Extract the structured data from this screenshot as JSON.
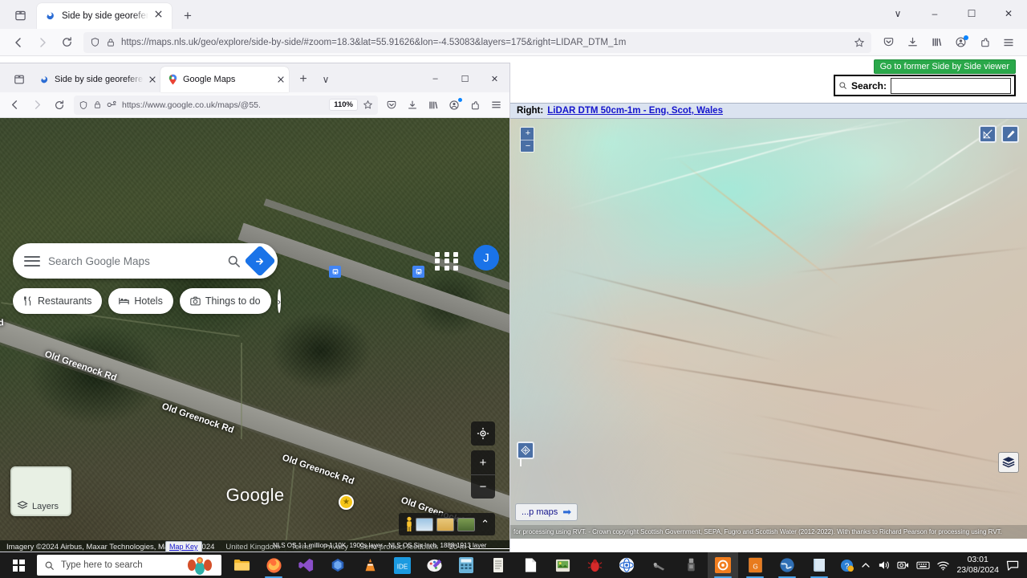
{
  "outer_browser": {
    "tab": {
      "title": "Side by side georeferenced map",
      "favicon": "firefox-icon"
    },
    "tab_list_icon": "tab-list-icon",
    "new_tab_label": "+",
    "nav": {
      "back": "back-arrow-icon",
      "forward": "forward-arrow-icon",
      "reload": "reload-icon"
    },
    "url": {
      "scheme": "https://",
      "domain_pre": "maps.",
      "domain_bold": "nls.uk",
      "path": "/geo/explore/side-by-side/#zoom=18.3&lat=55.91626&lon=-4.53083&layers=175&right=LIDAR_DTM_1m",
      "full": "https://maps.nls.uk/geo/explore/side-by-side/#zoom=18.3&lat=55.91626&lon=-4.53083&layers=175&right=LIDAR_DTM_1m",
      "shield_icon": "shield-icon",
      "lock_icon": "lock-icon",
      "bookmark_icon": "star-bookmark-icon"
    },
    "toolbar_icons": [
      "pocket-icon",
      "downloads-icon",
      "library-icon",
      "account-icon",
      "extensions-icon",
      "menu-icon"
    ],
    "window_controls": {
      "minimize": "–",
      "maximize": "☐",
      "close": "✕",
      "chevron": "∨"
    }
  },
  "inner_browser": {
    "tabs": [
      {
        "title": "Side by side georeferenced map",
        "favicon": "firefox-icon",
        "active": false
      },
      {
        "title": "Google Maps",
        "favicon": "gmaps-pin-icon",
        "active": true
      }
    ],
    "new_tab_label": "+",
    "tab_chevron": "∨",
    "window_controls": {
      "minimize": "–",
      "maximize": "☐",
      "close": "✕"
    },
    "url": {
      "scheme": "https://",
      "domain_pre": "www.",
      "domain_bold": "google.co.uk",
      "path": "/maps/@55.",
      "full": "https://www.google.co.uk/maps/@55."
    },
    "zoom_level": "110%",
    "toolbar_icons": [
      "pocket-icon",
      "downloads-icon",
      "library-icon",
      "account-icon",
      "extensions-icon",
      "menu-icon"
    ]
  },
  "google_maps": {
    "search": {
      "placeholder": "Search Google Maps",
      "value": ""
    },
    "menu_icon": "hamburger-icon",
    "search_icon": "search-icon",
    "directions_icon": "directions-icon",
    "chips": [
      {
        "label": "Restaurants",
        "icon": "restaurant-icon"
      },
      {
        "label": "Hotels",
        "icon": "hotel-icon"
      },
      {
        "label": "Things to do",
        "icon": "camera-icon"
      }
    ],
    "chips_next": "›",
    "apps_icon": "apps-grid-icon",
    "avatar_initial": "J",
    "road_labels": [
      "Old Greenock Rd",
      "Old Greenock Rd",
      "Old Greenock Rd",
      "Old Greenock Rd",
      "Rd"
    ],
    "layers_button": {
      "label": "Layers",
      "icon": "layers-icon"
    },
    "logo": "Google",
    "controls": {
      "locate": "locate-icon",
      "zoom_in": "+",
      "zoom_out": "−",
      "expand": "⌃"
    },
    "attribution": {
      "imagery": "Imagery ©2024 Airbus, Maxar Technologies, Map data ©2024",
      "region": "United Kingdom",
      "terms": "Terms",
      "privacy": "Privacy",
      "feedback": "Send product feedback",
      "scale": "20 m"
    }
  },
  "nls": {
    "former_viewer_button": "Go to former Side by Side viewer",
    "former_viewer_color": "#2aa84a",
    "search": {
      "label": "Search:",
      "icon": "search-icon",
      "value": "",
      "placeholder": ""
    },
    "right_layer": {
      "prefix": "Right:",
      "link": "LiDAR DTM 50cm-1m - Eng, Scot, Wales"
    },
    "zoom_in": "+",
    "zoom_out": "−",
    "tool_icons": [
      "measure-area-icon",
      "pencil-edit-icon"
    ],
    "center_marker_icon": "crosshair-diamond-icon",
    "layers_icon": "layers-stack-icon",
    "google_maps_button": {
      "label": "...p maps",
      "arrow": "➡"
    },
    "attribution_left": "NLS OS 1:1 million-1:10K, 1900s layer - NLS OS Six Inch, 1888-1913 layer",
    "attribution_right": "for processing using RVT. - Crown copyright Scottish Government, SEPA, Fugro and Scottish Water (2012-2022). With thanks to Richard Pearson for processing using RVT.",
    "map_key_button": "Map Key"
  },
  "taskbar": {
    "start_icon": "windows-start-icon",
    "search_placeholder": "Type here to search",
    "search_icon": "search-icon",
    "apps": [
      "file-explorer-icon",
      "firefox-icon",
      "visual-studio-icon",
      "directx-icon",
      "vlc-icon",
      "ide-icon",
      "paint-icon",
      "calculator-icon",
      "notes-icon",
      "document-icon",
      "photo-editor-icon",
      "bug-icon",
      "atom-icon",
      "tool-icon",
      "usb-icon",
      "orange-app-icon",
      "gimp-icon",
      "earth-icon",
      "book-icon"
    ],
    "tray": [
      "help-icon",
      "chevron-up-icon",
      "volume-icon",
      "camera-icon",
      "keyboard-icon",
      "wifi-icon"
    ],
    "clock_time": "03:01",
    "clock_date": "23/08/2024",
    "notifications_icon": "notification-icon"
  }
}
